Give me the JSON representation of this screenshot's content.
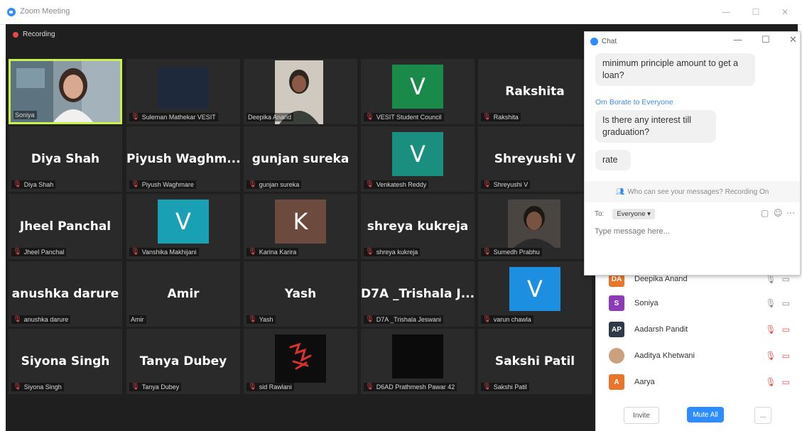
{
  "window": {
    "title": "Zoom Meeting",
    "minimize": "—",
    "maximize": "☐",
    "close": "✕"
  },
  "recording": {
    "label": "Recording"
  },
  "tiles": [
    {
      "name": "",
      "label": "Soniya",
      "muted": false
    },
    {
      "name": "",
      "label": "Suleman Mathekar VESIT",
      "muted": true
    },
    {
      "name": "",
      "label": "Deepika Anand",
      "muted": false
    },
    {
      "name": "",
      "avatar_letter": "V",
      "avatar_color": "#1a8a4a",
      "label": "VESIT Student Council",
      "muted": true
    },
    {
      "name": "Rakshita",
      "label": "Rakshita",
      "muted": true
    },
    {
      "name": "Diya Shah",
      "label": "Diya Shah",
      "muted": true
    },
    {
      "name": "Piyush Waghm...",
      "label": "Piyush Waghmare",
      "muted": true
    },
    {
      "name": "gunjan sureka",
      "label": "gunjan sureka",
      "muted": true
    },
    {
      "name": "",
      "avatar_letter": "V",
      "avatar_color": "#1a8f80",
      "label": "Venkatesh Reddy",
      "muted": true
    },
    {
      "name": "Shreyushi V",
      "label": "Shreyushi V",
      "muted": true
    },
    {
      "name": "Jheel Panchal",
      "label": "Jheel Panchal",
      "muted": true
    },
    {
      "name": "",
      "avatar_letter": "V",
      "avatar_color": "#1aa0b4",
      "label": "Vanshika Makhijani",
      "muted": true
    },
    {
      "name": "",
      "avatar_letter": "K",
      "avatar_color": "#6d4a3e",
      "label": "Karina Karira",
      "muted": true
    },
    {
      "name": "shreya kukreja",
      "label": "shreya kukreja",
      "muted": true
    },
    {
      "name": "",
      "label": "Sumedh Prabhu",
      "muted": true
    },
    {
      "name": "anushka darure",
      "label": "anushka darure",
      "muted": true
    },
    {
      "name": "Amir",
      "label": "Amir",
      "muted": false
    },
    {
      "name": "Yash",
      "label": "Yash",
      "muted": true
    },
    {
      "name": "D7A _Trishala J...",
      "label": "D7A _Trishala Jeswani",
      "muted": true
    },
    {
      "name": "",
      "avatar_letter": "V",
      "avatar_color": "#1c8fe0",
      "label": "varun chawla",
      "muted": true
    },
    {
      "name": "Siyona Singh",
      "label": "Siyona Singh",
      "muted": true
    },
    {
      "name": "Tanya Dubey",
      "label": "Tanya Dubey",
      "muted": true
    },
    {
      "name": "",
      "label": "sid Rawlani",
      "muted": true
    },
    {
      "name": "",
      "label": "D6AD Prathmesh Pawar 42",
      "muted": true
    },
    {
      "name": "Sakshi Patil",
      "label": "Sakshi Patil",
      "muted": true
    }
  ],
  "chat": {
    "title": "Chat",
    "messages": [
      {
        "text": "minimum principle amount to get a loan?"
      },
      {
        "sender": "Om Borate to Everyone",
        "text": "Is there any interest till graduation?"
      },
      {
        "text": "rate"
      }
    ],
    "info": "Who can see your messages? Recording On",
    "to_label": "To:",
    "to_value": "Everyone ▾",
    "input_placeholder": "Type message here..."
  },
  "participants": {
    "items": [
      {
        "initials": "DA",
        "name": "Deepika Anand",
        "color": "#e8752a",
        "mic": "on"
      },
      {
        "initials": "S",
        "name": "Soniya",
        "color": "#8e3bb8",
        "mic": "on"
      },
      {
        "initials": "AP",
        "name": "Aadarsh Pandit",
        "color": "#2e3a48",
        "mic": "off"
      },
      {
        "initials": "",
        "name": "Aaditya Khetwani",
        "color": "#c9a17e",
        "mic": "off"
      },
      {
        "initials": "A",
        "name": "Aarya",
        "color": "#e8752a",
        "mic": "off"
      }
    ],
    "invite_label": "Invite",
    "mute_all_label": "Mute All",
    "more_label": "..."
  }
}
